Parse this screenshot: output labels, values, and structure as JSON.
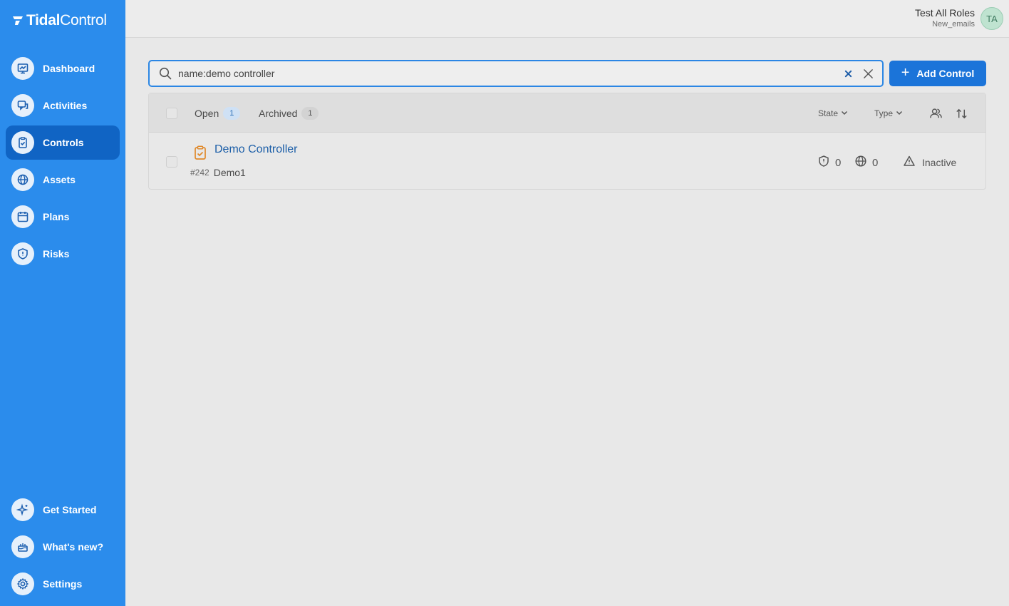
{
  "brand": {
    "name_bold": "Tidal",
    "name_light": "Control"
  },
  "sidebar": {
    "items": [
      {
        "label": "Dashboard",
        "icon": "dashboard-icon"
      },
      {
        "label": "Activities",
        "icon": "activities-icon"
      },
      {
        "label": "Controls",
        "icon": "controls-icon",
        "active": true
      },
      {
        "label": "Assets",
        "icon": "globe-icon"
      },
      {
        "label": "Plans",
        "icon": "calendar-icon"
      },
      {
        "label": "Risks",
        "icon": "shield-icon"
      }
    ],
    "bottom_items": [
      {
        "label": "Get Started",
        "icon": "sparkle-icon"
      },
      {
        "label": "What's new?",
        "icon": "cake-icon"
      },
      {
        "label": "Settings",
        "icon": "gear-icon"
      }
    ]
  },
  "user": {
    "name": "Test All Roles",
    "org": "New_emails",
    "initials": "TA"
  },
  "search": {
    "value": "name:demo controller",
    "placeholder": "Search controls"
  },
  "add_button": {
    "label": "Add Control"
  },
  "tabs": [
    {
      "label": "Open",
      "count": "1"
    },
    {
      "label": "Archived",
      "count": "1"
    }
  ],
  "filters": {
    "state": "State",
    "type": "Type"
  },
  "rows": [
    {
      "title": "Demo Controller",
      "id": "#242",
      "subtitle": "Demo1",
      "risks_count": "0",
      "assets_count": "0",
      "status": "Inactive"
    }
  ],
  "colors": {
    "sidebar": "#2b8cec",
    "sidebar_active": "#1064c4",
    "primary": "#1b74d9",
    "link": "#1d5fa8",
    "control_type_icon": "#e0892a"
  }
}
